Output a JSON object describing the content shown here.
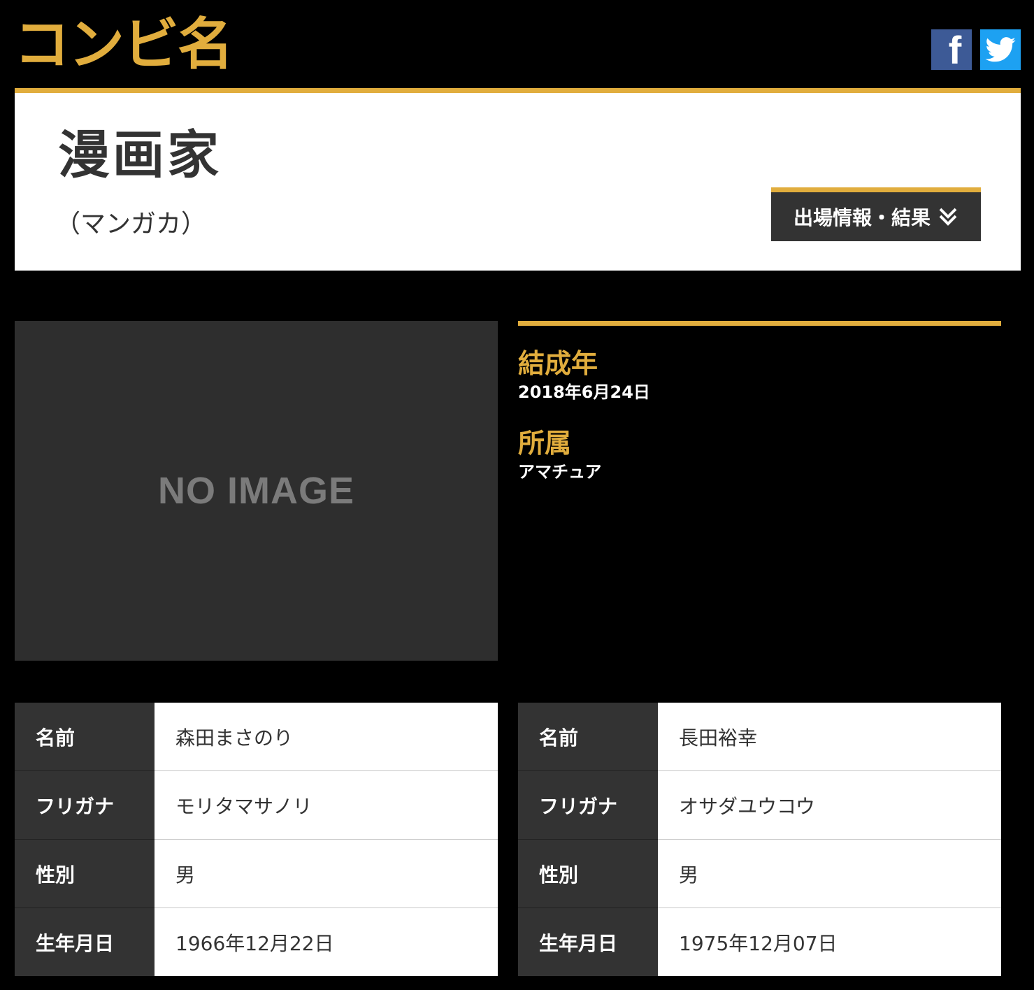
{
  "header": {
    "logo": "コンビ名",
    "facebook_label": "f",
    "twitter_icon": "twitter-bird"
  },
  "combi": {
    "name": "漫画家",
    "reading": "（マンガカ）",
    "results_button": "出場情報・結果"
  },
  "photo": {
    "placeholder": "NO IMAGE"
  },
  "info": {
    "formed_label": "結成年",
    "formed_value": "2018年6月24日",
    "agency_label": "所属",
    "agency_value": "アマチュア"
  },
  "members": [
    {
      "rows": [
        {
          "label": "名前",
          "value": "森田まさのり"
        },
        {
          "label": "フリガナ",
          "value": "モリタマサノリ"
        },
        {
          "label": "性別",
          "value": "男"
        },
        {
          "label": "生年月日",
          "value": "1966年12月22日"
        }
      ]
    },
    {
      "rows": [
        {
          "label": "名前",
          "value": "長田裕幸"
        },
        {
          "label": "フリガナ",
          "value": "オサダユウコウ"
        },
        {
          "label": "性別",
          "value": "男"
        },
        {
          "label": "生年月日",
          "value": "1975年12月07日"
        }
      ]
    }
  ],
  "colors": {
    "accent": "#e1ad3d",
    "dark": "#333333",
    "facebook": "#3d5a96",
    "twitter": "#1da1f2"
  }
}
